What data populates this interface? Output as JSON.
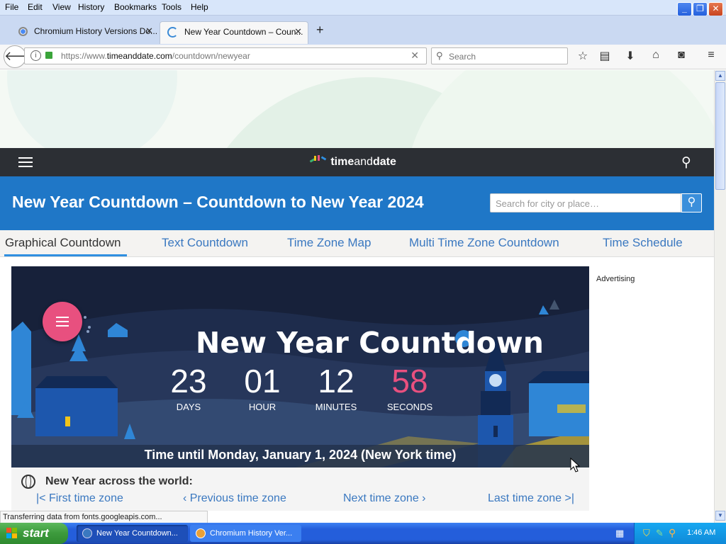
{
  "menubar": {
    "items": [
      "File",
      "Edit",
      "View",
      "History",
      "Bookmarks",
      "Tools",
      "Help"
    ]
  },
  "tabs": [
    {
      "title": "Chromium History Versions Do...",
      "active": false
    },
    {
      "title": "New Year Countdown – Coun...",
      "active": true
    }
  ],
  "navbar": {
    "url_prefix": "https://www.",
    "url_host": "timeanddate.com",
    "url_path": "/countdown/newyear",
    "search_placeholder": "Search"
  },
  "site": {
    "logo_text_a": "time",
    "logo_text_b": "and",
    "logo_text_c": "date",
    "page_title": "New Year Countdown – Countdown to New Year 2024",
    "search_placeholder": "Search for city or place…",
    "subtabs": [
      "Graphical Countdown",
      "Text Countdown",
      "Time Zone Map",
      "Multi Time Zone Countdown",
      "Time Schedule"
    ],
    "advertising_label": "Advertising"
  },
  "countdown": {
    "heading": "New Year Countdown",
    "days": "23",
    "days_label": "DAYS",
    "hours": "01",
    "hours_label": "HOUR",
    "minutes": "12",
    "minutes_label": "MINUTES",
    "seconds": "58",
    "seconds_label": "SECONDS",
    "caption": "Time until Monday, January 1, 2024 (New York time)"
  },
  "world": {
    "heading": "New Year across the world:",
    "first": "First time zone",
    "previous": "Previous time zone",
    "next": "Next time zone",
    "last": "Last time zone"
  },
  "status": {
    "text": "Transferring data from fonts.googleapis.com..."
  },
  "taskbar": {
    "start_label": "start",
    "items": [
      "New Year Countdown...",
      "Chromium History Ver..."
    ],
    "clock": "1:46 AM"
  },
  "colors": {
    "site_blue": "#1f77c7",
    "nav_dark": "#2c2f34",
    "seconds_pink": "#e8507f",
    "menu_fab": "#e8507f"
  }
}
